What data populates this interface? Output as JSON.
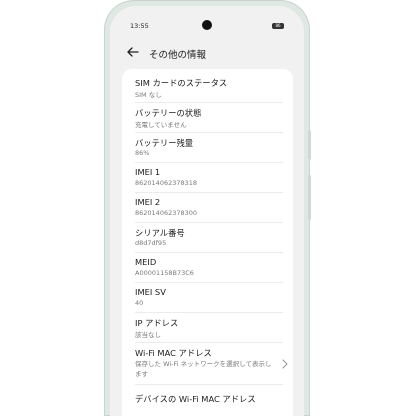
{
  "statusbar": {
    "time": "13:55",
    "battery": "86"
  },
  "header": {
    "title": "その他の情報"
  },
  "items": [
    {
      "title": "SIM カードのステータス",
      "value": "SIM なし"
    },
    {
      "title": "バッテリーの状態",
      "value": "充電していません"
    },
    {
      "title": "バッテリー残量",
      "value": "86%"
    },
    {
      "title": "IMEI 1",
      "value": "862014062378318"
    },
    {
      "title": "IMEI 2",
      "value": "862014062378300"
    },
    {
      "title": "シリアル番号",
      "value": "d8d7df95"
    },
    {
      "title": "MEID",
      "value": "A00001158B73C6"
    },
    {
      "title": "IMEI SV",
      "value": "40"
    },
    {
      "title": "IP アドレス",
      "value": "該当なし"
    },
    {
      "title": "Wi-Fi MAC アドレス",
      "value": "保存した Wi-Fi ネットワークを選択して表示します",
      "value_line2": "示します"
    },
    {
      "title": "デバイスの Wi-Fi MAC アドレス",
      "value": ""
    }
  ],
  "icons": {
    "back": "back-arrow-icon",
    "chevron": "chevron-right-icon"
  }
}
